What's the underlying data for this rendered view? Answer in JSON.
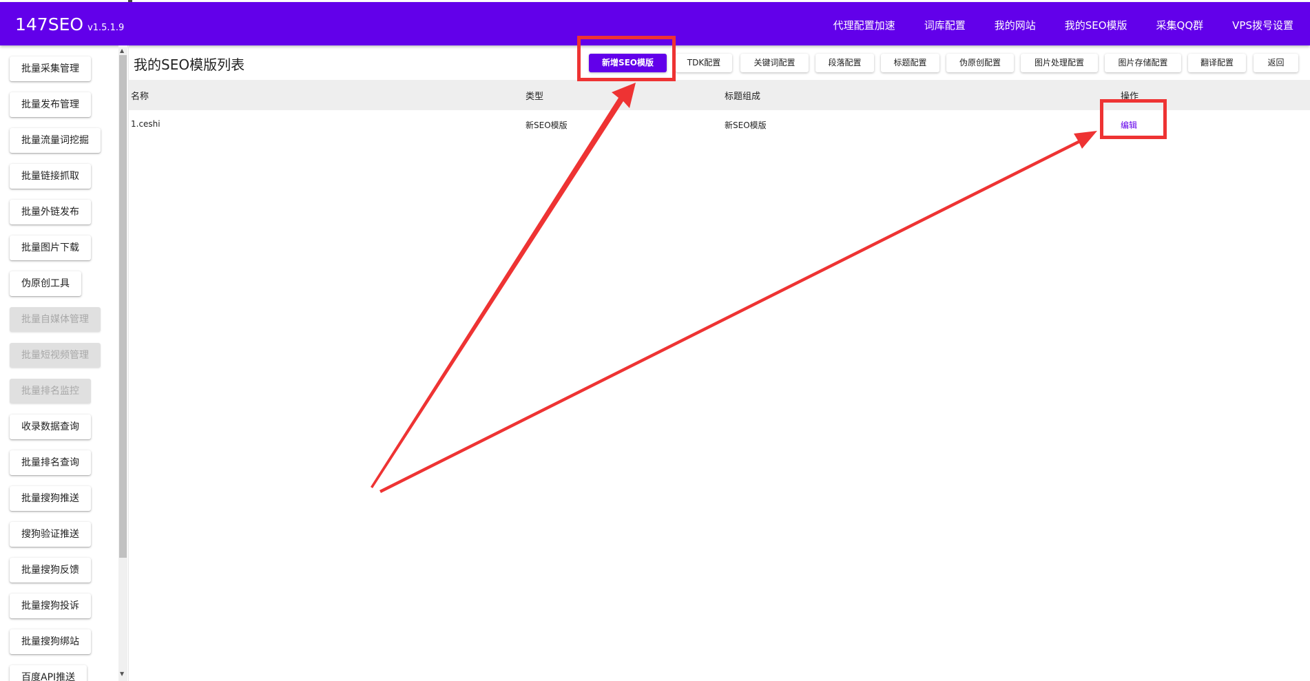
{
  "app": {
    "name": "147SEO",
    "version": "v1.5.1.9"
  },
  "topnav": [
    "代理配置加速",
    "词库配置",
    "我的网站",
    "我的SEO模版",
    "采集QQ群",
    "VPS拨号设置"
  ],
  "sidebar": [
    {
      "label": "批量采集管理",
      "disabled": false
    },
    {
      "label": "批量发布管理",
      "disabled": false
    },
    {
      "label": "批量流量词挖掘",
      "disabled": false
    },
    {
      "label": "批量链接抓取",
      "disabled": false
    },
    {
      "label": "批量外链发布",
      "disabled": false
    },
    {
      "label": "批量图片下载",
      "disabled": false
    },
    {
      "label": "伪原创工具",
      "disabled": false
    },
    {
      "label": "批量自媒体管理",
      "disabled": true
    },
    {
      "label": "批量短视频管理",
      "disabled": true
    },
    {
      "label": "批量排名监控",
      "disabled": true
    },
    {
      "label": "收录数据查询",
      "disabled": false
    },
    {
      "label": "批量排名查询",
      "disabled": false
    },
    {
      "label": "批量搜狗推送",
      "disabled": false
    },
    {
      "label": "搜狗验证推送",
      "disabled": false
    },
    {
      "label": "批量搜狗反馈",
      "disabled": false
    },
    {
      "label": "批量搜狗投诉",
      "disabled": false
    },
    {
      "label": "批量搜狗绑站",
      "disabled": false
    },
    {
      "label": "百度API推送",
      "disabled": false
    }
  ],
  "main": {
    "title": "我的SEO模版列表",
    "toolbar": [
      "新增SEO模版",
      "TDK配置",
      "关键词配置",
      "段落配置",
      "标题配置",
      "伪原创配置",
      "图片处理配置",
      "图片存储配置",
      "翻译配置",
      "返回"
    ],
    "table": {
      "headers": [
        "名称",
        "类型",
        "标题组成",
        "操作"
      ],
      "rows": [
        {
          "name": "1.ceshi",
          "type": "新SEO模版",
          "title_comp": "新SEO模版",
          "action": "编辑"
        }
      ]
    }
  },
  "colors": {
    "accent": "#6200ea",
    "highlight": "#ee3333",
    "disabled_bg": "#e0e0e0",
    "table_header_bg": "#eeeeee"
  },
  "annotations": {
    "shape": "red-rectangle-highlight",
    "arrow": "red-arrow"
  }
}
